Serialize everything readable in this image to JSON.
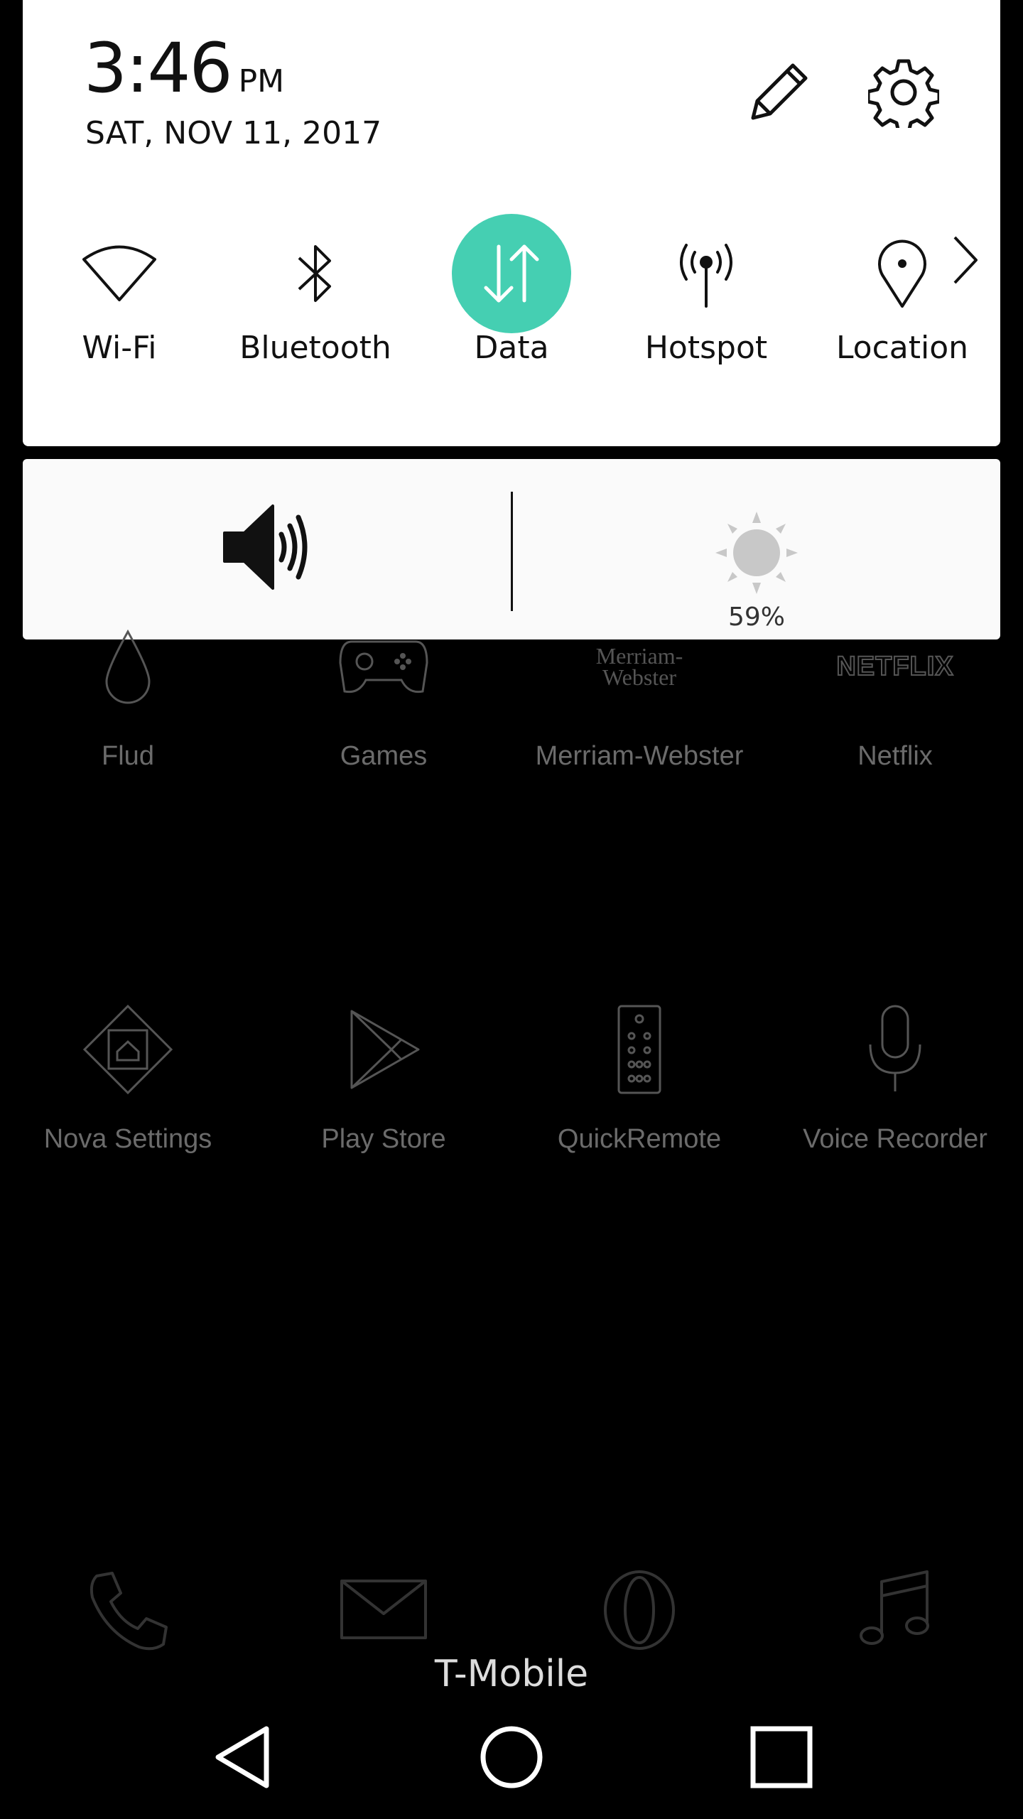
{
  "status": {
    "time": "3:46",
    "ampm": "PM",
    "date": "SAT, NOV 11, 2017"
  },
  "quick_toggles": [
    {
      "label": "Wi-Fi",
      "icon": "wifi-icon"
    },
    {
      "label": "Bluetooth",
      "icon": "bluetooth-icon"
    },
    {
      "label": "Data",
      "icon": "data-arrows-icon",
      "active": true
    },
    {
      "label": "Hotspot",
      "icon": "hotspot-icon"
    },
    {
      "label": "Location",
      "icon": "location-icon"
    }
  ],
  "brightness": {
    "percent_label": "59%",
    "value": 0.59
  },
  "apps_row1": [
    {
      "label": "Flud",
      "icon": "drop-icon"
    },
    {
      "label": "Games",
      "icon": "gamepad-icon"
    },
    {
      "label": "Merriam-Webster",
      "icon": "merriam-webster-logo",
      "logo_text": "Merriam-\nWebster"
    },
    {
      "label": "Netflix",
      "icon": "netflix-logo",
      "logo_text": "NETFLIX"
    }
  ],
  "apps_row2": [
    {
      "label": "Nova Settings",
      "icon": "nova-settings-icon"
    },
    {
      "label": "Play Store",
      "icon": "play-store-icon"
    },
    {
      "label": "QuickRemote",
      "icon": "remote-icon"
    },
    {
      "label": "Voice Recorder",
      "icon": "microphone-icon"
    }
  ],
  "dock": [
    "phone-icon",
    "mail-icon",
    "opera-icon",
    "music-icon"
  ],
  "carrier": "T-Mobile",
  "colors": {
    "accent": "#45cfb2",
    "panel": "#ffffff",
    "background": "#000000"
  }
}
